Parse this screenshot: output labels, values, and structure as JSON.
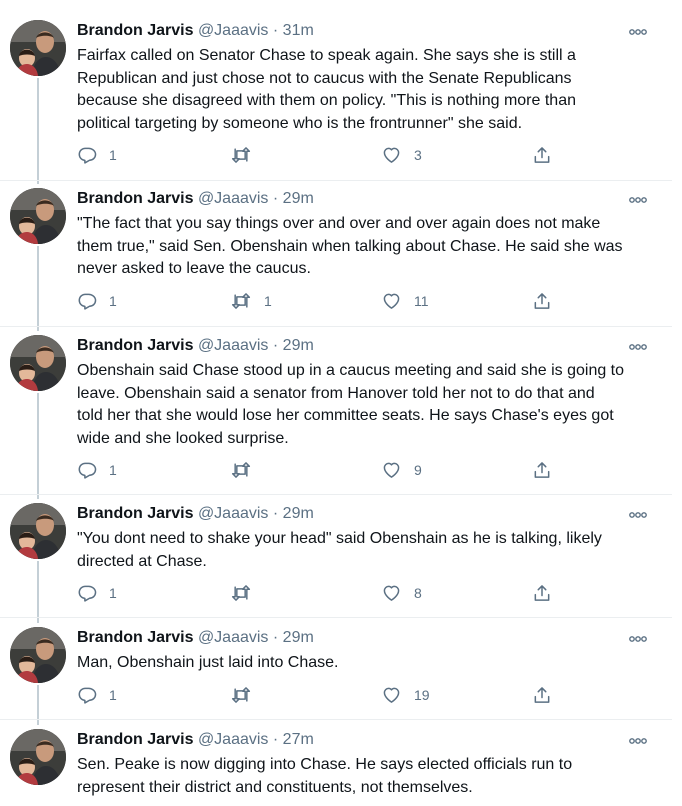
{
  "author": {
    "name": "Brandon Jarvis",
    "handle": "@Jaaavis",
    "separator": "·"
  },
  "colors": {
    "secondary_text": "#5b7083",
    "thread_line": "#c4cfd6",
    "divider": "#ebeef0"
  },
  "icons": {
    "reply": "reply-icon",
    "retweet": "retweet-icon",
    "like": "like-icon",
    "share": "share-icon",
    "more": "more-options-icon"
  },
  "tweets": [
    {
      "time": "31m",
      "text": "Fairfax called on Senator Chase to speak again. She says she is still a\nRepublican and just chose not to caucus with the Senate Republicans\nbecause she disagreed with them on policy. \"This is nothing more than\npolitical targeting by someone who is the frontrunner\" she said.",
      "replies": "1",
      "retweets": "",
      "likes": "3"
    },
    {
      "time": "29m",
      "text": "\"The fact that you say things over and over and over again does not make\nthem true,\" said Sen. Obenshain when talking about Chase. He said she was\nnever asked to leave the caucus.",
      "replies": "1",
      "retweets": "1",
      "likes": "11"
    },
    {
      "time": "29m",
      "text": "Obenshain said Chase stood up in a caucus meeting and said she is going to\nleave. Obenshain said a senator from Hanover told her not to do that and\ntold her that she would lose her committee seats. He says Chase's eyes got\nwide and she looked surprise.",
      "replies": "1",
      "retweets": "",
      "likes": "9"
    },
    {
      "time": "29m",
      "text": "\"You dont need to shake your head\" said Obenshain as he is talking, likely\ndirected at Chase.",
      "replies": "1",
      "retweets": "",
      "likes": "8"
    },
    {
      "time": "29m",
      "text": "Man, Obenshain just laid into Chase.",
      "replies": "1",
      "retweets": "",
      "likes": "19"
    },
    {
      "time": "27m",
      "text": "Sen. Peake is now digging into Chase. He says elected officials run to\nrepresent their district and constituents, not themselves.",
      "replies": "",
      "retweets": "",
      "likes": ""
    }
  ]
}
